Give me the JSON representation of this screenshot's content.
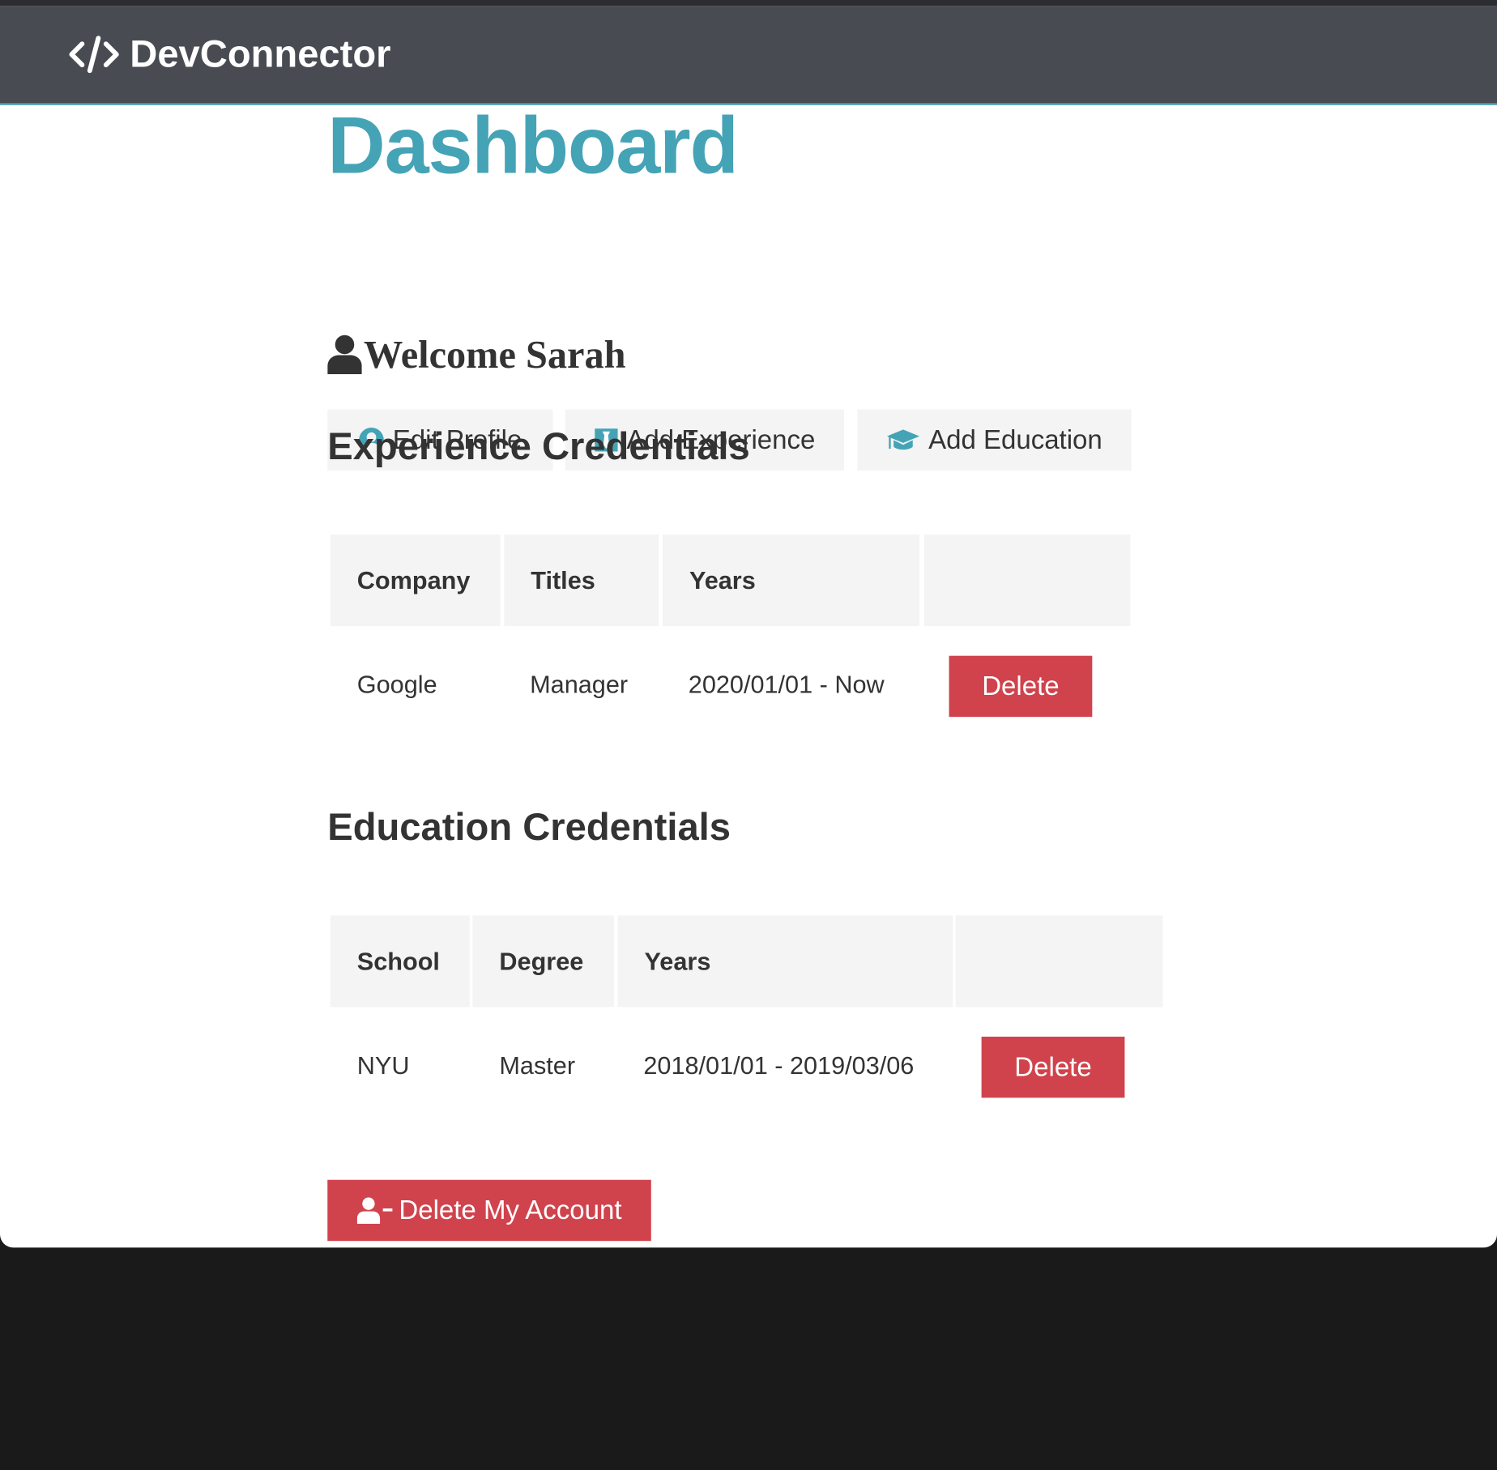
{
  "navbar": {
    "brand": "DevConnector",
    "brand_icon": "code-icon"
  },
  "dashboard": {
    "title": "Dashboard",
    "welcome": "Welcome Sarah",
    "welcome_icon": "user-icon"
  },
  "actions": [
    {
      "label": "Edit Profile",
      "icon": "user-circle-icon"
    },
    {
      "label": "Add Experience",
      "icon": "black-tie-icon"
    },
    {
      "label": "Add Education",
      "icon": "graduation-cap-icon"
    }
  ],
  "experience": {
    "heading": "Experience Credentials",
    "headers": [
      "Company",
      "Titles",
      "Years",
      ""
    ],
    "rows": [
      {
        "company": "Google",
        "title": "Manager",
        "years": "2020/01/01 - Now",
        "action": "Delete"
      }
    ]
  },
  "education": {
    "heading": "Education Credentials",
    "headers": [
      "School",
      "Degree",
      "Years",
      ""
    ],
    "rows": [
      {
        "school": "NYU",
        "degree": "Master",
        "years": "2018/01/01 - 2019/03/06",
        "action": "Delete"
      }
    ]
  },
  "delete_account": {
    "label": "Delete My Account",
    "icon": "user-minus-icon"
  },
  "colors": {
    "primary": "#45a3b6",
    "danger": "#d0434d",
    "dark": "#484b52",
    "light": "#f4f4f4",
    "text": "#333333"
  }
}
